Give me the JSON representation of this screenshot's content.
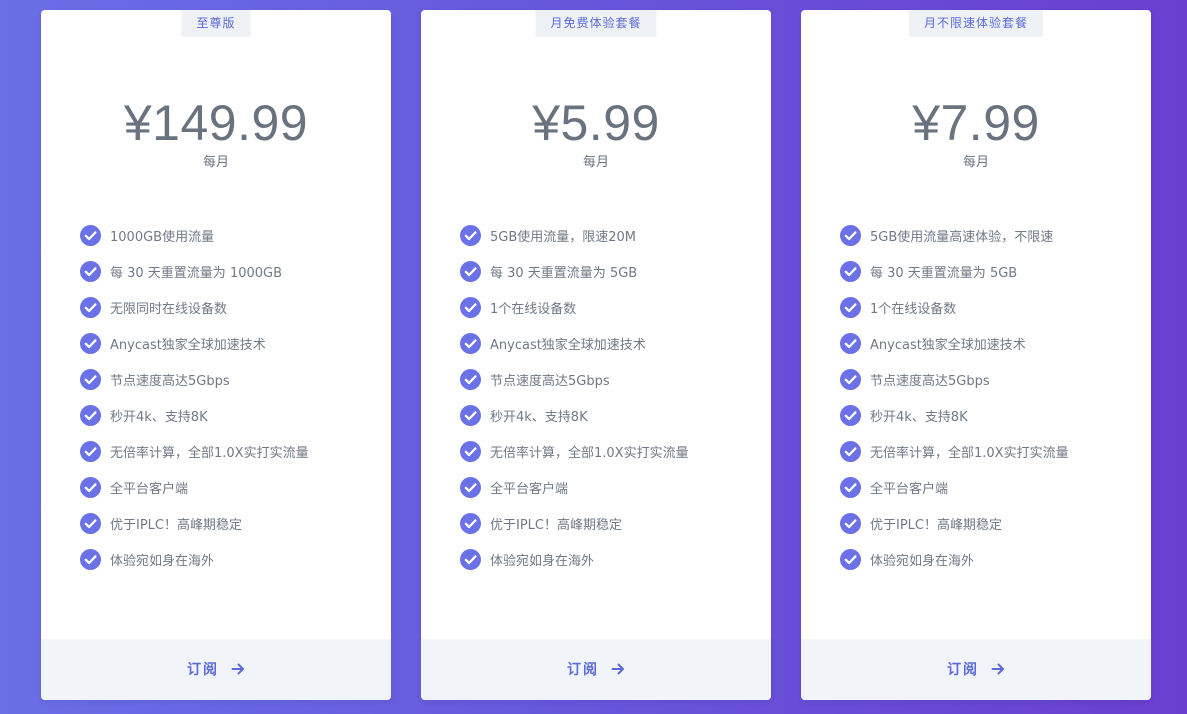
{
  "colors": {
    "accent": "#5b6ad8",
    "check": "#6b71e6",
    "price_text": "#69727f",
    "feature_text": "#707986",
    "badge_bg": "#eef2f7",
    "footer_bg": "#f1f4f8"
  },
  "plans": [
    {
      "badge": "至尊版",
      "price": "¥149.99",
      "period": "每月",
      "features": [
        "1000GB使用流量",
        "每 30 天重置流量为 1000GB",
        "无限同时在线设备数",
        "Anycast独家全球加速技术",
        "节点速度高达5Gbps",
        "秒开4k、支持8K",
        "无倍率计算，全部1.0X实打实流量",
        "全平台客户端",
        "优于IPLC！高峰期稳定",
        "体验宛如身在海外"
      ],
      "subscribe_label": "订阅",
      "check_icon": "check-circle-icon",
      "arrow_icon": "arrow-right-icon"
    },
    {
      "badge": "月免费体验套餐",
      "price": "¥5.99",
      "period": "每月",
      "features": [
        "5GB使用流量，限速20M",
        "每 30 天重置流量为 5GB",
        "1个在线设备数",
        "Anycast独家全球加速技术",
        "节点速度高达5Gbps",
        "秒开4k、支持8K",
        "无倍率计算，全部1.0X实打实流量",
        "全平台客户端",
        "优于IPLC！高峰期稳定",
        "体验宛如身在海外"
      ],
      "subscribe_label": "订阅",
      "check_icon": "check-circle-icon",
      "arrow_icon": "arrow-right-icon"
    },
    {
      "badge": "月不限速体验套餐",
      "price": "¥7.99",
      "period": "每月",
      "features": [
        "5GB使用流量高速体验，不限速",
        "每 30 天重置流量为 5GB",
        "1个在线设备数",
        "Anycast独家全球加速技术",
        "节点速度高达5Gbps",
        "秒开4k、支持8K",
        "无倍率计算，全部1.0X实打实流量",
        "全平台客户端",
        "优于IPLC！高峰期稳定",
        "体验宛如身在海外"
      ],
      "subscribe_label": "订阅",
      "check_icon": "check-circle-icon",
      "arrow_icon": "arrow-right-icon"
    }
  ]
}
